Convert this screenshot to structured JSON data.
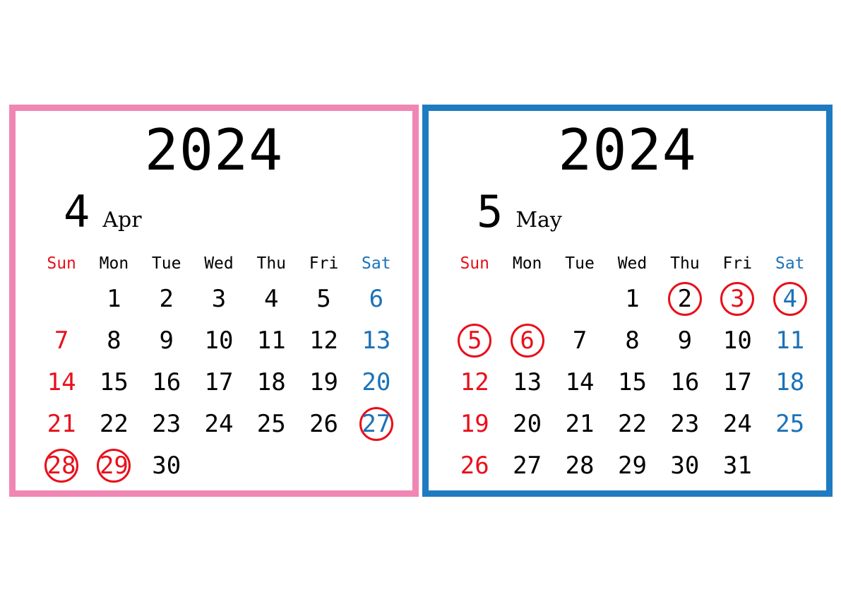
{
  "page": {
    "background": "#ffffff",
    "colors": {
      "sunday_red": "#e8101b",
      "saturday_blue": "#1b72b8",
      "default_black": "#000000",
      "marker_red": "#e8101b",
      "april_border_pink": "#f086b4",
      "may_border_blue": "#1f7bc1"
    }
  },
  "calendars": [
    {
      "id": "april-2024",
      "year": "2024",
      "month_number": "4",
      "month_name": "Apr",
      "border_color": "#f086b4",
      "weekdays": [
        {
          "label": "Sun",
          "color": "c-sun"
        },
        {
          "label": "Mon",
          "color": "c-black"
        },
        {
          "label": "Tue",
          "color": "c-black"
        },
        {
          "label": "Wed",
          "color": "c-black"
        },
        {
          "label": "Thu",
          "color": "c-black"
        },
        {
          "label": "Fri",
          "color": "c-black"
        },
        {
          "label": "Sat",
          "color": "c-sat"
        }
      ],
      "weeks": [
        [
          {
            "day": "",
            "color": "c-black",
            "circled": false
          },
          {
            "day": "1",
            "color": "c-black",
            "circled": false
          },
          {
            "day": "2",
            "color": "c-black",
            "circled": false
          },
          {
            "day": "3",
            "color": "c-black",
            "circled": false
          },
          {
            "day": "4",
            "color": "c-black",
            "circled": false
          },
          {
            "day": "5",
            "color": "c-black",
            "circled": false
          },
          {
            "day": "6",
            "color": "c-blue",
            "circled": false
          }
        ],
        [
          {
            "day": "7",
            "color": "c-red",
            "circled": false
          },
          {
            "day": "8",
            "color": "c-black",
            "circled": false
          },
          {
            "day": "9",
            "color": "c-black",
            "circled": false
          },
          {
            "day": "10",
            "color": "c-black",
            "circled": false
          },
          {
            "day": "11",
            "color": "c-black",
            "circled": false
          },
          {
            "day": "12",
            "color": "c-black",
            "circled": false
          },
          {
            "day": "13",
            "color": "c-blue",
            "circled": false
          }
        ],
        [
          {
            "day": "14",
            "color": "c-red",
            "circled": false
          },
          {
            "day": "15",
            "color": "c-black",
            "circled": false
          },
          {
            "day": "16",
            "color": "c-black",
            "circled": false
          },
          {
            "day": "17",
            "color": "c-black",
            "circled": false
          },
          {
            "day": "18",
            "color": "c-black",
            "circled": false
          },
          {
            "day": "19",
            "color": "c-black",
            "circled": false
          },
          {
            "day": "20",
            "color": "c-blue",
            "circled": false
          }
        ],
        [
          {
            "day": "21",
            "color": "c-red",
            "circled": false
          },
          {
            "day": "22",
            "color": "c-black",
            "circled": false
          },
          {
            "day": "23",
            "color": "c-black",
            "circled": false
          },
          {
            "day": "24",
            "color": "c-black",
            "circled": false
          },
          {
            "day": "25",
            "color": "c-black",
            "circled": false
          },
          {
            "day": "26",
            "color": "c-black",
            "circled": false
          },
          {
            "day": "27",
            "color": "c-blue",
            "circled": true
          }
        ],
        [
          {
            "day": "28",
            "color": "c-red",
            "circled": true
          },
          {
            "day": "29",
            "color": "c-red",
            "circled": true
          },
          {
            "day": "30",
            "color": "c-black",
            "circled": false
          },
          {
            "day": "",
            "color": "c-black",
            "circled": false
          },
          {
            "day": "",
            "color": "c-black",
            "circled": false
          },
          {
            "day": "",
            "color": "c-black",
            "circled": false
          },
          {
            "day": "",
            "color": "c-black",
            "circled": false
          }
        ]
      ]
    },
    {
      "id": "may-2024",
      "year": "2024",
      "month_number": "5",
      "month_name": "May",
      "border_color": "#1f7bc1",
      "weekdays": [
        {
          "label": "Sun",
          "color": "c-sun"
        },
        {
          "label": "Mon",
          "color": "c-black"
        },
        {
          "label": "Tue",
          "color": "c-black"
        },
        {
          "label": "Wed",
          "color": "c-black"
        },
        {
          "label": "Thu",
          "color": "c-black"
        },
        {
          "label": "Fri",
          "color": "c-black"
        },
        {
          "label": "Sat",
          "color": "c-sat"
        }
      ],
      "weeks": [
        [
          {
            "day": "",
            "color": "c-black",
            "circled": false
          },
          {
            "day": "",
            "color": "c-black",
            "circled": false
          },
          {
            "day": "",
            "color": "c-black",
            "circled": false
          },
          {
            "day": "1",
            "color": "c-black",
            "circled": false
          },
          {
            "day": "2",
            "color": "c-black",
            "circled": true
          },
          {
            "day": "3",
            "color": "c-red",
            "circled": true
          },
          {
            "day": "4",
            "color": "c-blue",
            "circled": true
          }
        ],
        [
          {
            "day": "5",
            "color": "c-red",
            "circled": true
          },
          {
            "day": "6",
            "color": "c-red",
            "circled": true
          },
          {
            "day": "7",
            "color": "c-black",
            "circled": false
          },
          {
            "day": "8",
            "color": "c-black",
            "circled": false
          },
          {
            "day": "9",
            "color": "c-black",
            "circled": false
          },
          {
            "day": "10",
            "color": "c-black",
            "circled": false
          },
          {
            "day": "11",
            "color": "c-blue",
            "circled": false
          }
        ],
        [
          {
            "day": "12",
            "color": "c-red",
            "circled": false
          },
          {
            "day": "13",
            "color": "c-black",
            "circled": false
          },
          {
            "day": "14",
            "color": "c-black",
            "circled": false
          },
          {
            "day": "15",
            "color": "c-black",
            "circled": false
          },
          {
            "day": "16",
            "color": "c-black",
            "circled": false
          },
          {
            "day": "17",
            "color": "c-black",
            "circled": false
          },
          {
            "day": "18",
            "color": "c-blue",
            "circled": false
          }
        ],
        [
          {
            "day": "19",
            "color": "c-red",
            "circled": false
          },
          {
            "day": "20",
            "color": "c-black",
            "circled": false
          },
          {
            "day": "21",
            "color": "c-black",
            "circled": false
          },
          {
            "day": "22",
            "color": "c-black",
            "circled": false
          },
          {
            "day": "23",
            "color": "c-black",
            "circled": false
          },
          {
            "day": "24",
            "color": "c-black",
            "circled": false
          },
          {
            "day": "25",
            "color": "c-blue",
            "circled": false
          }
        ],
        [
          {
            "day": "26",
            "color": "c-red",
            "circled": false
          },
          {
            "day": "27",
            "color": "c-black",
            "circled": false
          },
          {
            "day": "28",
            "color": "c-black",
            "circled": false
          },
          {
            "day": "29",
            "color": "c-black",
            "circled": false
          },
          {
            "day": "30",
            "color": "c-black",
            "circled": false
          },
          {
            "day": "31",
            "color": "c-black",
            "circled": false
          },
          {
            "day": "",
            "color": "c-black",
            "circled": false
          }
        ]
      ]
    }
  ]
}
